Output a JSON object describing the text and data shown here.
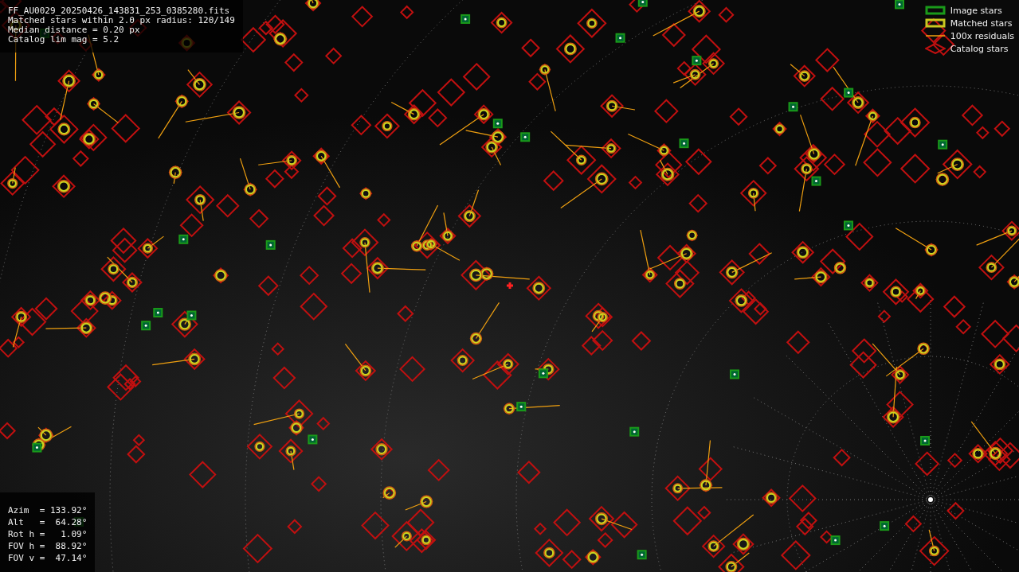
{
  "info_lines": [
    "FF_AU0029_20250426_143831_253_0385280.fits",
    "Matched stars within 2.0 px radius: 120/149",
    "Median distance = 0.20 px",
    "Catalog lim mag = 5.2"
  ],
  "legend": [
    {
      "kind": "image",
      "label": "Image stars"
    },
    {
      "kind": "matched",
      "label": "Matched stars"
    },
    {
      "kind": "residual",
      "label": "100x residuals"
    },
    {
      "kind": "catalog",
      "label": "Catalog stars"
    }
  ],
  "pointing_lines": [
    "Azim  = 133.92°",
    "Alt   =  64.28°",
    "Rot h =   1.09°",
    "FOV h =  88.92°",
    "FOV v =  47.14°"
  ]
}
